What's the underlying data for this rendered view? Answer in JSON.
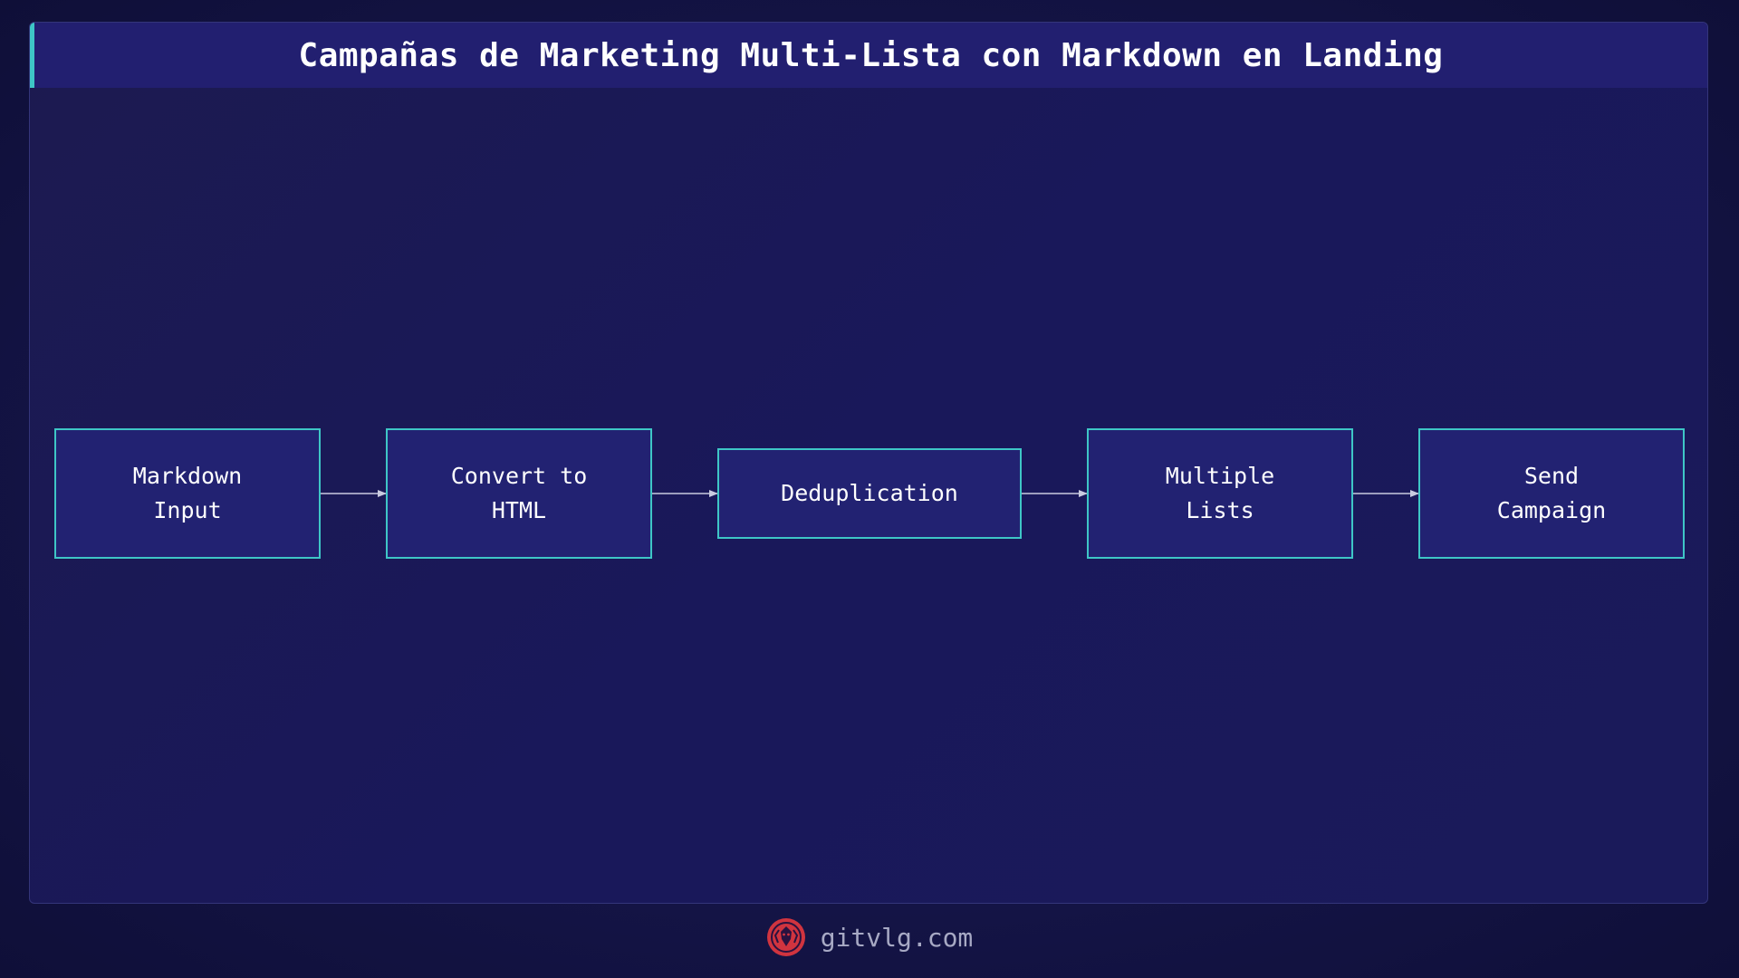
{
  "header": {
    "title": "Campañas de Marketing Multi-Lista con Markdown en Landing"
  },
  "flow": {
    "nodes": [
      {
        "id": "markdown-input",
        "label": "Markdown\nInput"
      },
      {
        "id": "convert-to-html",
        "label": "Convert to\nHTML"
      },
      {
        "id": "deduplication",
        "label": "Deduplication"
      },
      {
        "id": "multiple-lists",
        "label": "Multiple\nLists"
      },
      {
        "id": "send-campaign",
        "label": "Send\nCampaign"
      }
    ],
    "edges": [
      {
        "from": "markdown-input",
        "to": "convert-to-html"
      },
      {
        "from": "convert-to-html",
        "to": "deduplication"
      },
      {
        "from": "deduplication",
        "to": "multiple-lists"
      },
      {
        "from": "multiple-lists",
        "to": "send-campaign"
      }
    ]
  },
  "footer": {
    "site": "gitvlg.com",
    "logo_icon": "lion-logo-icon"
  },
  "colors": {
    "accent": "#3ec6c6",
    "node_fill": "#222272",
    "title_bar": "#221f70",
    "background": "#19185a",
    "logo": "#d0343f"
  }
}
